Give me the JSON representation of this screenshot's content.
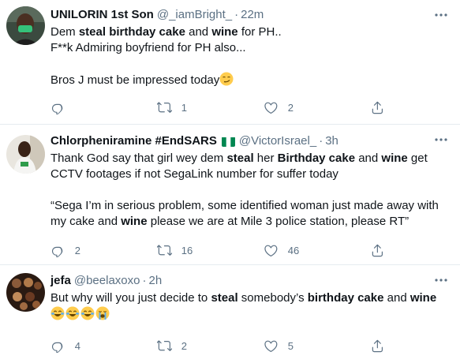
{
  "tweets": [
    {
      "name": "UNILORIN 1st Son",
      "handle": "@_iamBright_",
      "time": "22m",
      "body": [
        [
          {
            "t": "Dem "
          },
          {
            "t": "steal",
            "b": true
          },
          {
            "t": " "
          },
          {
            "t": "birthday cake",
            "b": true
          },
          {
            "t": " and "
          },
          {
            "t": "wine",
            "b": true
          },
          {
            "t": " for PH.."
          }
        ],
        [
          {
            "t": "F**k Admiring boyfriend for PH also..."
          }
        ],
        [
          {
            "t": ""
          }
        ],
        [
          {
            "t": "Bros J must be impressed today"
          },
          {
            "emoji": "smirk"
          }
        ]
      ],
      "reply_count": "",
      "retweet_count": "1",
      "like_count": "2"
    },
    {
      "name": "Chlorpheniramine #EndSARS",
      "has_flag": true,
      "handle": "@VictorIsrael_",
      "time": "3h",
      "body": [
        [
          {
            "t": "Thank God say that girl wey dem "
          },
          {
            "t": "steal",
            "b": true
          },
          {
            "t": " her "
          },
          {
            "t": "Birthday cake",
            "b": true
          },
          {
            "t": " and "
          },
          {
            "t": "wine",
            "b": true
          },
          {
            "t": " get"
          }
        ],
        [
          {
            "t": "CCTV footages if not SegaLink number for suffer today"
          }
        ],
        [
          {
            "t": ""
          }
        ],
        [
          {
            "t": "“Sega I’m in serious problem, some identified woman just made away with"
          }
        ],
        [
          {
            "t": "my cake and "
          },
          {
            "t": "wine",
            "b": true
          },
          {
            "t": " please we are at Mile 3 police station, please RT”"
          }
        ]
      ],
      "reply_count": "2",
      "retweet_count": "16",
      "like_count": "46"
    },
    {
      "name": "jefa",
      "handle": "@beelaxoxo",
      "time": "2h",
      "body": [
        [
          {
            "t": "But why will you just decide to "
          },
          {
            "t": "steal",
            "b": true
          },
          {
            "t": " somebody’s "
          },
          {
            "t": "birthday cake",
            "b": true
          },
          {
            "t": " and "
          },
          {
            "t": "wine",
            "b": true
          }
        ],
        [
          {
            "emoji": "joy"
          },
          {
            "emoji": "joy"
          },
          {
            "emoji": "joy"
          },
          {
            "emoji": "sob"
          }
        ]
      ],
      "reply_count": "4",
      "retweet_count": "2",
      "like_count": "5"
    }
  ],
  "colors": {
    "text": "#0f1419",
    "secondary": "#5b7083",
    "divider": "#e6ecf0"
  },
  "icons": [
    "reply-icon",
    "retweet-icon",
    "like-icon",
    "share-icon",
    "more-icon",
    "nigeria-flag-icon"
  ]
}
